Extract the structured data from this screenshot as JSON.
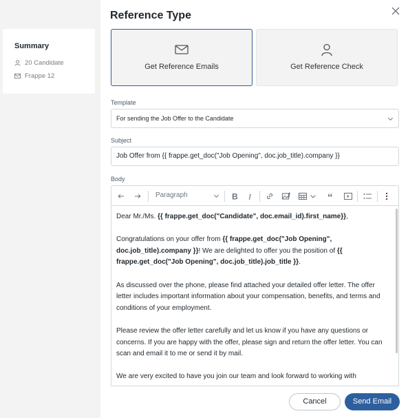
{
  "summary": {
    "title": "Summary",
    "candidate": "20 Candidate",
    "opening": "Frappe 12"
  },
  "dialog": {
    "title": "Reference Type",
    "options": [
      {
        "label": "Get Reference Emails",
        "icon": "mail-icon",
        "selected": true
      },
      {
        "label": "Get Reference Check",
        "icon": "user-icon",
        "selected": false
      }
    ],
    "template_label": "Template",
    "template_value": "For sending the Job Offer to the Candidate",
    "subject_label": "Subject",
    "subject_value": "Job Offer from  {{ frappe.get_doc(\"Job Opening\", doc.job_title).company }}",
    "body_label": "Body"
  },
  "toolbar": {
    "paragraph": "Paragraph"
  },
  "body": {
    "greeting_prefix": "Dear Mr./Ms. ",
    "greeting_var": "{{ frappe.get_doc(\"Candidate\", doc.email_id).first_name}}",
    "greeting_suffix": ",",
    "p2_a": "Congratulations on your offer from ",
    "p2_var1": "{{ frappe.get_doc(\"Job Opening\", doc.job_title).company }}",
    "p2_b": "! We are delighted to offer you the position of ",
    "p2_var2": "{{ frappe.get_doc(\"Job Opening\", doc.job_title).job_title }}",
    "p2_c": ".",
    "p3": "As discussed over the phone, please find attached your detailed offer letter. The offer letter includes important information about your compensation, benefits, and terms and conditions of your employment.",
    "p4": "Please review the offer letter carefully and let us know if you have any questions or concerns. If you are happy with the offer, please sign and return the offer letter. You can scan and email it to me or send it by mail.",
    "p5": "We are very excited to have you join our team and look forward to working with"
  },
  "buttons": {
    "cancel": "Cancel",
    "send": "Send Email"
  },
  "colors": {
    "accent": "#2d5f9e",
    "selected_border": "#2d5f8f"
  }
}
